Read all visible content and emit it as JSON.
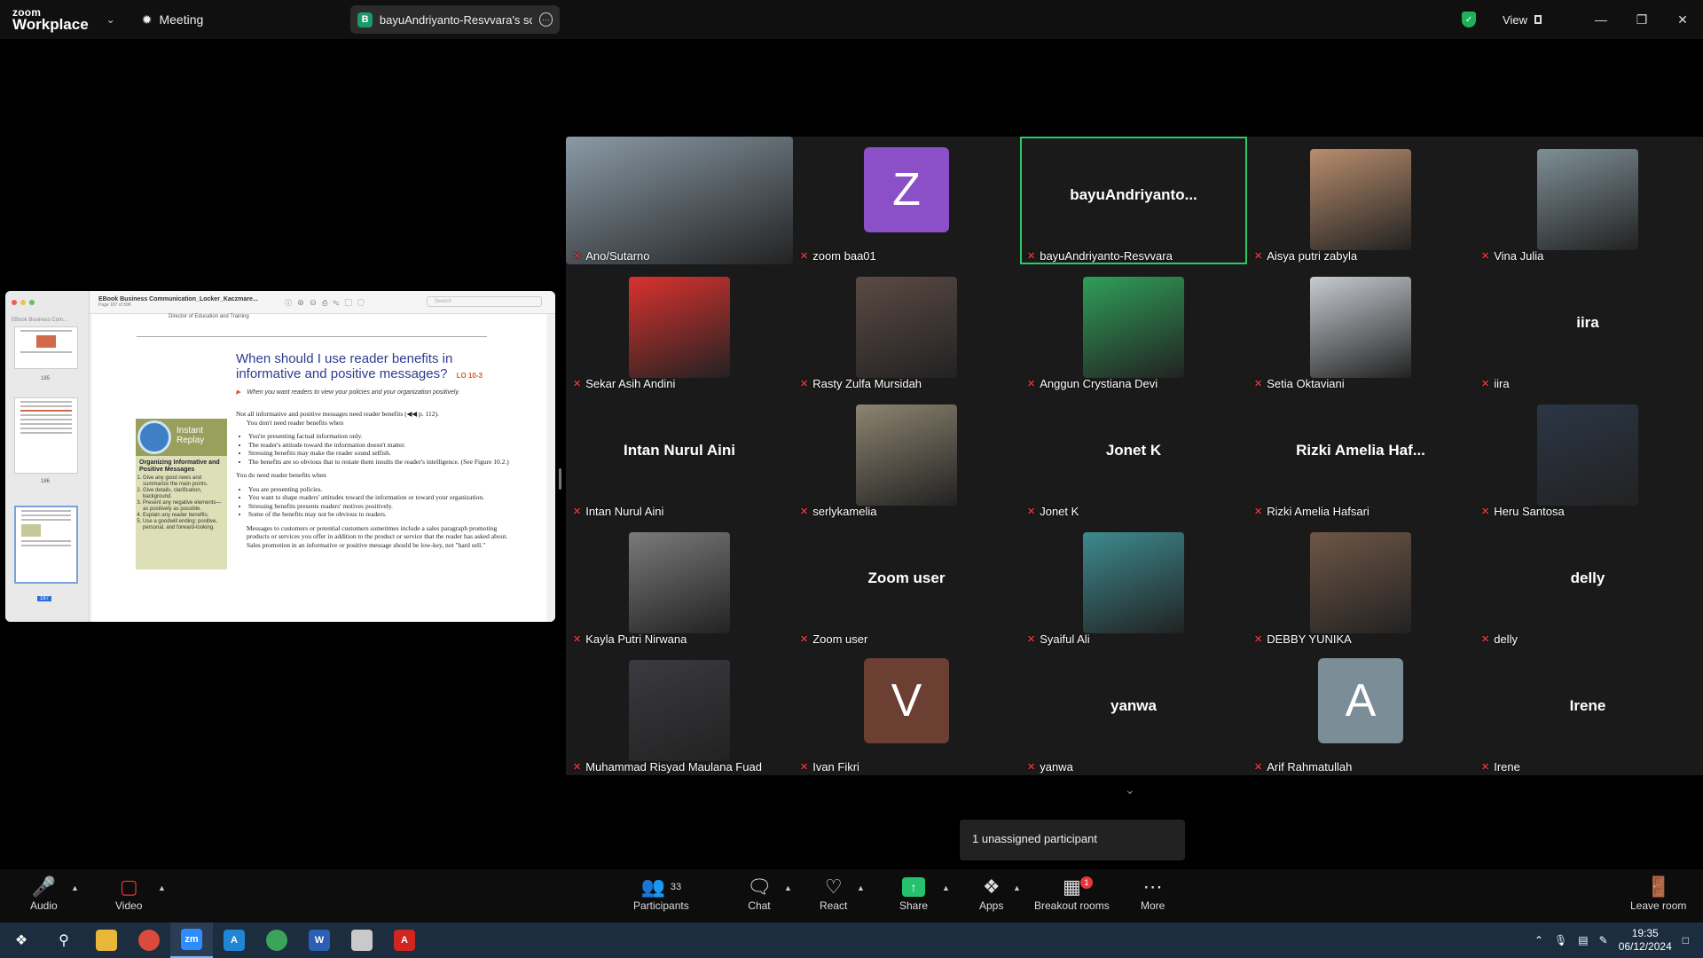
{
  "app": {
    "logo_top": "zoom",
    "logo_bottom": "Workplace"
  },
  "header": {
    "meeting_label": "Meeting",
    "share_badge_letter": "B",
    "share_title": "bayuAndriyanto-Resvvara's scree",
    "view_label": "View"
  },
  "share_window": {
    "doc_title": "EBook Business Communication_Locker_Kaczmare...",
    "doc_page": "Page 187 of 596",
    "search_placeholder": "Search",
    "sidebar_title": "EBook Business Com...",
    "thumb_nums": [
      "185",
      "186",
      "187"
    ],
    "top_text": "Director of Education and Training",
    "heading": "When should I use reader benefits in informative and positive messages?",
    "lo_tag": "LO 10-3",
    "subheading": "When you want readers to view your policies and your organization positively.",
    "replay_title_1": "Instant",
    "replay_title_2": "Replay",
    "replay_heading": "Organizing Informative and Positive Messages",
    "replay_items": [
      "Give any good news and summarize the main points.",
      "Give details, clarification, background.",
      "Present any negative elements—as positively as possible.",
      "Explain any reader benefits.",
      "Use a goodwill ending: positive, personal, and forward-looking."
    ],
    "para1": "Not all informative and positive messages need reader benefits (◀◀ p. 112).",
    "para1b": "You don't need reader benefits when",
    "list1": [
      "You're presenting factual information only.",
      "The reader's attitude toward the information doesn't matter.",
      "Stressing benefits may make the reader sound selfish.",
      "The benefits are so obvious that to restate them insults the reader's intelligence. (See Figure 10.2.)"
    ],
    "para2": "You do need reader benefits when",
    "list2": [
      "You are presenting policies.",
      "You want to shape readers' attitudes toward the information or toward your organization.",
      "Stressing benefits presents readers' motives positively.",
      "Some of the benefits may not be obvious to readers."
    ],
    "para3": "Messages to customers or potential customers sometimes include a sales paragraph promoting products or services you offer in addition to the product or service that the reader has asked about. Sales promotion in an informative or positive message should be low-key, not \"hard sell.\""
  },
  "participants": [
    {
      "name": "Ano/Sutarno",
      "kind": "photo",
      "color": "#8a9aa6"
    },
    {
      "name": "zoom baa01",
      "kind": "avatar",
      "letter": "Z",
      "color": "#8b4fc8"
    },
    {
      "name": "bayuAndriyanto-Resvvara",
      "kind": "text",
      "display": "bayuAndriyanto...",
      "active": true
    },
    {
      "name": "Aisya putri zabyla",
      "kind": "photo",
      "color": "#b98d6d"
    },
    {
      "name": "Vina Julia",
      "kind": "photo",
      "color": "#7e8f97"
    },
    {
      "name": "Sekar Asih Andini",
      "kind": "photo",
      "color": "#d9322e"
    },
    {
      "name": "Rasty Zulfa Mursidah",
      "kind": "photo",
      "color": "#5b4a44"
    },
    {
      "name": "Anggun Crystiana Devi",
      "kind": "photo",
      "color": "#2f9e58"
    },
    {
      "name": "Setia Oktaviani",
      "kind": "photo",
      "color": "#c7ccd2"
    },
    {
      "name": "iira",
      "kind": "text",
      "display": "iira"
    },
    {
      "name": "Intan Nurul Aini",
      "kind": "text",
      "display": "Intan Nurul Aini"
    },
    {
      "name": "serlykamelia",
      "kind": "photo",
      "color": "#8d8470"
    },
    {
      "name": "Jonet K",
      "kind": "text",
      "display": "Jonet K"
    },
    {
      "name": "Rizki Amelia Hafsari",
      "kind": "text",
      "display": "Rizki  Amelia  Haf..."
    },
    {
      "name": "Heru Santosa",
      "kind": "photo",
      "color": "#2b3645"
    },
    {
      "name": "Kayla Putri Nirwana",
      "kind": "photo",
      "color": "#7a7a7a"
    },
    {
      "name": "Zoom user",
      "kind": "text",
      "display": "Zoom user"
    },
    {
      "name": "Syaiful Ali",
      "kind": "photo",
      "color": "#3d8a8f"
    },
    {
      "name": "DEBBY YUNIKA",
      "kind": "photo",
      "color": "#6e5646"
    },
    {
      "name": "delly",
      "kind": "text",
      "display": "delly"
    },
    {
      "name": "Muhammad Risyad Maulana Fuad",
      "kind": "photo",
      "color": "#3a3a40"
    },
    {
      "name": "Ivan Fikri",
      "kind": "avatar",
      "letter": "V",
      "color": "#6b3f32"
    },
    {
      "name": "yanwa",
      "kind": "text",
      "display": "yanwa"
    },
    {
      "name": "Arif Rahmatullah",
      "kind": "avatar",
      "letter": "A",
      "color": "#7b8d96"
    },
    {
      "name": "Irene",
      "kind": "text",
      "display": "Irene"
    }
  ],
  "unassigned_text": "1 unassigned participant",
  "toolbar": {
    "audio": "Audio",
    "video": "Video",
    "participants": "Participants",
    "participants_count": "33",
    "chat": "Chat",
    "react": "React",
    "share": "Share",
    "apps": "Apps",
    "breakout": "Breakout rooms",
    "breakout_badge": "1",
    "more": "More",
    "leave": "Leave room"
  },
  "taskbar": {
    "time": "19:35",
    "date": "06/12/2024"
  },
  "colors": {
    "accent_green": "#2bc96a",
    "mute_red": "#e0343a"
  }
}
